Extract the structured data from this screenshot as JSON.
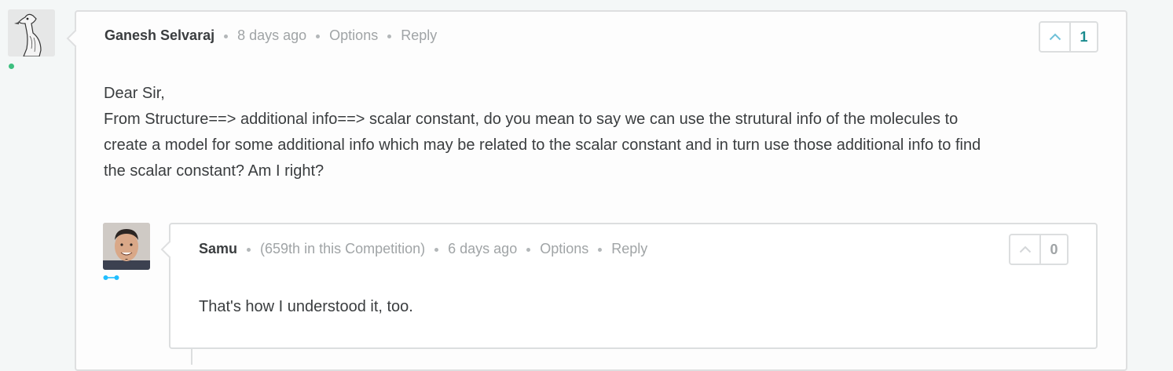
{
  "comment": {
    "author": "Ganesh Selvaraj",
    "time": "8 days ago",
    "options_label": "Options",
    "reply_label": "Reply",
    "votes": "1",
    "body_lines": [
      "Dear Sir,",
      "From Structure==> additional info==> scalar constant, do you mean to say we can use the strutural info of the molecules to",
      "create a model for some additional info which may be related to the scalar constant and in turn use those additional info to find",
      "the scalar constant? Am I right?"
    ]
  },
  "reply": {
    "author": "Samu",
    "rank": "(659th in this Competition)",
    "time": "6 days ago",
    "options_label": "Options",
    "reply_label": "Reply",
    "votes": "0",
    "body": "That's how I understood it, too."
  },
  "colors": {
    "online": "#3dbf7f",
    "upvoted": "#1a8b8e",
    "tier": "#20beff"
  },
  "icons": {
    "upvote": "chevron-up-icon",
    "online": "online-status-icon",
    "tier": "contributor-tier-icon"
  }
}
